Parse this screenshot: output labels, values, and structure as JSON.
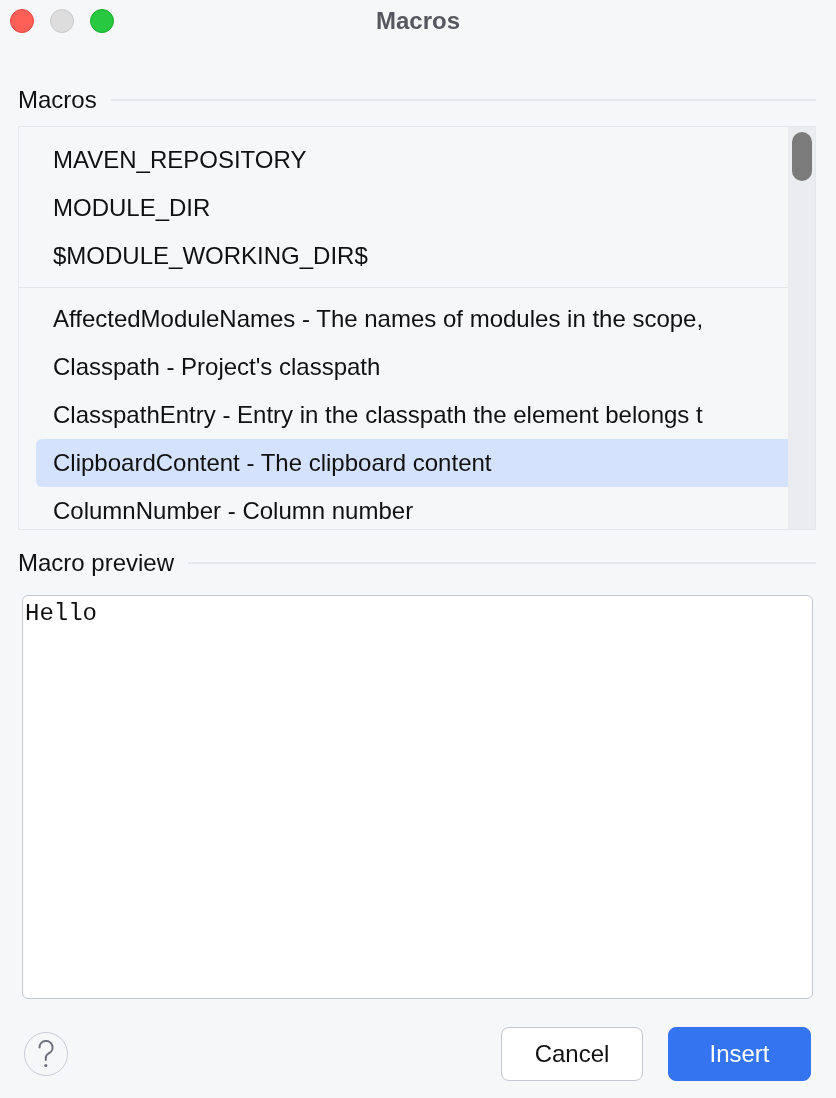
{
  "window": {
    "title": "Macros",
    "controls": [
      {
        "kind": "close",
        "disabled": false
      },
      {
        "kind": "minimize",
        "disabled": true
      },
      {
        "kind": "zoom",
        "disabled": false
      }
    ]
  },
  "macros_section": {
    "title": "Macros",
    "groups": [
      {
        "items": [
          {
            "label": "MAVEN_REPOSITORY",
            "selected": false
          },
          {
            "label": "MODULE_DIR",
            "selected": false
          },
          {
            "label": "$MODULE_WORKING_DIR$",
            "selected": false
          }
        ]
      },
      {
        "items": [
          {
            "label": "AffectedModuleNames - The names of modules in the scope,",
            "selected": false
          },
          {
            "label": "Classpath - Project's classpath",
            "selected": false
          },
          {
            "label": "ClasspathEntry - Entry in the classpath the element belongs t",
            "selected": false
          },
          {
            "label": "ClipboardContent - The clipboard content",
            "selected": true
          },
          {
            "label": "ColumnNumber - Column number",
            "selected": false
          }
        ]
      }
    ]
  },
  "preview_section": {
    "title": "Macro preview",
    "value": "Hello"
  },
  "buttons": [
    {
      "label": "Cancel",
      "kind": "secondary"
    },
    {
      "label": "Insert",
      "kind": "primary"
    }
  ]
}
